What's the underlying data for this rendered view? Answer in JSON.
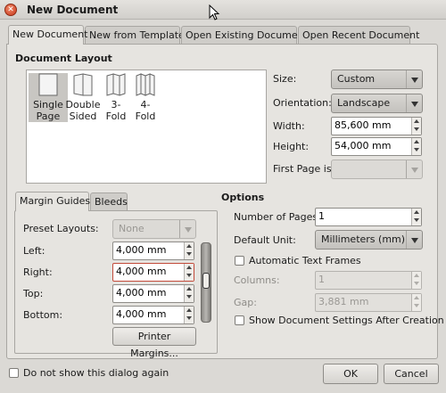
{
  "window": {
    "title": "New Document"
  },
  "tabs": [
    "New Document",
    "New from Template",
    "Open Existing Document",
    "Open Recent Document"
  ],
  "layout": {
    "heading": "Document Layout",
    "options": [
      {
        "line1": "Single",
        "line2": "Page"
      },
      {
        "line1": "Double",
        "line2": "Sided"
      },
      {
        "line1": "3-",
        "line2": "Fold"
      },
      {
        "line1": "4-",
        "line2": "Fold"
      }
    ]
  },
  "page": {
    "size_label": "Size:",
    "size_value": "Custom",
    "orientation_label": "Orientation:",
    "orientation_value": "Landscape",
    "width_label": "Width:",
    "width_value": "85,600 mm",
    "height_label": "Height:",
    "height_value": "54,000 mm",
    "firstpage_label": "First Page is:",
    "firstpage_value": ""
  },
  "margins": {
    "tab_guides": "Margin Guides",
    "tab_bleeds": "Bleeds",
    "preset_label": "Preset Layouts:",
    "preset_value": "None",
    "left_label": "Left:",
    "left_value": "4,000 mm",
    "right_label": "Right:",
    "right_value": "4,000 mm",
    "top_label": "Top:",
    "top_value": "4,000 mm",
    "bottom_label": "Bottom:",
    "bottom_value": "4,000 mm",
    "printer_button": "Printer Margins..."
  },
  "options": {
    "heading": "Options",
    "pages_label": "Number of Pages:",
    "pages_value": "1",
    "unit_label": "Default Unit:",
    "unit_value": "Millimeters (mm)",
    "auto_frames_label": "Automatic Text Frames",
    "columns_label": "Columns:",
    "columns_value": "1",
    "gap_label": "Gap:",
    "gap_value": "3,881 mm",
    "show_settings_label": "Show Document Settings After Creation"
  },
  "footer": {
    "dont_show_label": "Do not show this dialog again",
    "ok_label": "OK",
    "cancel_label": "Cancel"
  },
  "colors": {
    "accent_close": "#c8381c",
    "focus_border": "#c24a3a"
  },
  "icons": {
    "close": "close-icon",
    "cursor": "mouse-cursor-icon",
    "chain": "chain-link-icon"
  }
}
